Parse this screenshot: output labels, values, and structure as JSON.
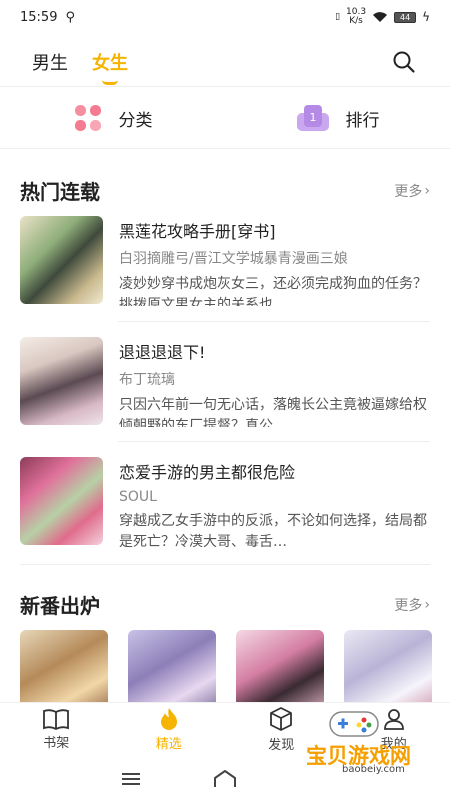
{
  "status": {
    "time": "15:59",
    "net_speed": "10.3",
    "net_unit": "K/s",
    "battery": "44"
  },
  "tabs": {
    "male": "男生",
    "female": "女生"
  },
  "quick": {
    "category": "分类",
    "ranking": "排行"
  },
  "hot": {
    "title": "热门连载",
    "more": "更多",
    "books": [
      {
        "title": "黑莲花攻略手册[穿书]",
        "author": "白羽摘雕弓/晋江文学城暴青漫画三娘",
        "desc": "凌妙妙穿书成炮灰女三，还必须完成狗血的任务？挑拨原文男女主的关系也…"
      },
      {
        "title": "退退退退下!",
        "author": "布丁琉璃",
        "desc": "只因六年前一句无心话，落魄长公主竟被逼嫁给权倾朝野的东厂提督？真公…"
      },
      {
        "title": "恋爱手游的男主都很危险",
        "author": "SOUL",
        "desc": "穿越成乙女手游中的反派，不论如何选择，结局都是死亡？冷漠大哥、毒舌…"
      }
    ]
  },
  "fresh": {
    "title": "新番出炉",
    "more": "更多"
  },
  "nav": {
    "shelf": "书架",
    "featured": "精选",
    "discover": "发现",
    "mine": "我的"
  },
  "watermark": {
    "text": "宝贝游戏网",
    "url": "baobeiy.com"
  },
  "colors": {
    "accent": "#f5b400"
  }
}
